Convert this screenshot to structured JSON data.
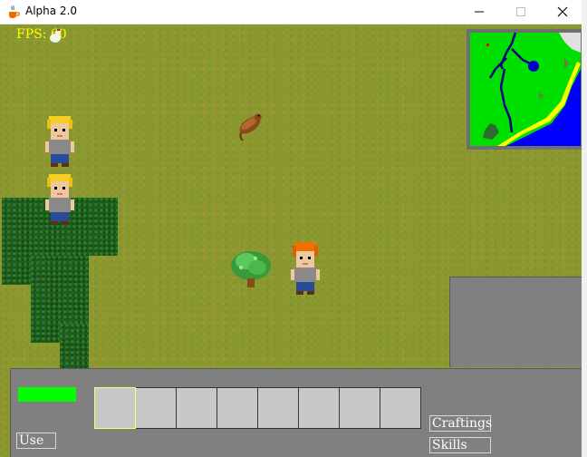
{
  "window": {
    "title": "Alpha 2.0",
    "icons": {
      "app": "java-cup-icon",
      "minimize": "minimize-icon",
      "maximize": "maximize-icon",
      "close": "close-icon"
    }
  },
  "hud": {
    "fps_label": "FPS: 60",
    "health_fraction": 1.0,
    "health_color": "#00ff00",
    "slot_count": 8,
    "selected_slot": 1,
    "use_label": "Use",
    "crafting_label": "Craftings",
    "skills_label": "Skills"
  },
  "colors": {
    "grass": "#8a9a2e",
    "hedge": "#1f5e1f",
    "panel": "#808080",
    "slot": "#c8c8c8",
    "fps_text": "#ffff00",
    "minimap_land": "#00e000",
    "minimap_water": "#0000ff",
    "minimap_sand": "#ffff00"
  },
  "sprites": {
    "npcs": [
      "blonde-villager",
      "blonde-villager"
    ],
    "player": "orange-haired-player",
    "bush": "green-bush",
    "animal": "brown-rat"
  }
}
